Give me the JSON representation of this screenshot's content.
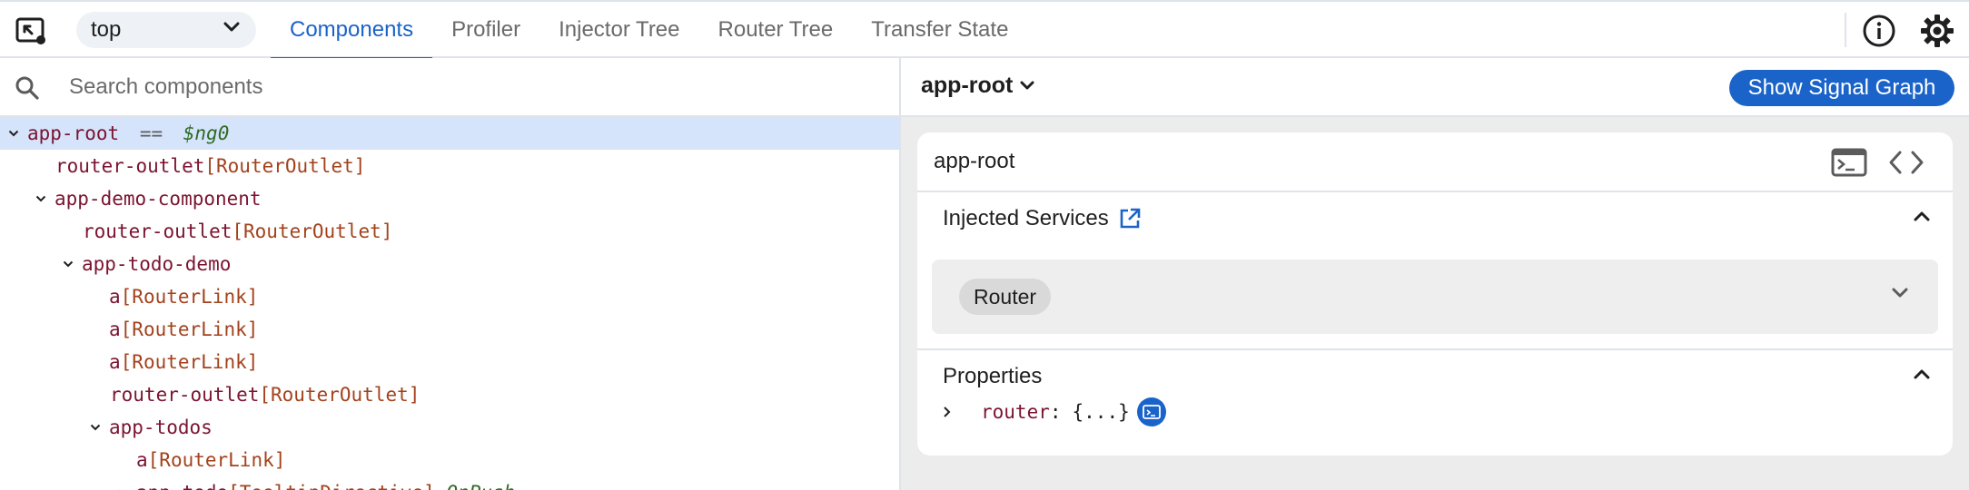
{
  "toolbar": {
    "frame_value": "top",
    "tabs": [
      {
        "label": "Components"
      },
      {
        "label": "Profiler"
      },
      {
        "label": "Injector Tree"
      },
      {
        "label": "Router Tree"
      },
      {
        "label": "Transfer State"
      }
    ],
    "active_tab": "Components"
  },
  "search": {
    "placeholder": "Search components",
    "value": ""
  },
  "tree": {
    "nodes": [
      {
        "element": "app-root",
        "directive": "",
        "eq": "==",
        "var": "$ng0",
        "expanded": true,
        "selected": true
      },
      {
        "element": "router-outlet",
        "directive": "[RouterOutlet]"
      },
      {
        "element": "app-demo-component",
        "directive": "",
        "expanded": true
      },
      {
        "element": "router-outlet",
        "directive": "[RouterOutlet]"
      },
      {
        "element": "app-todo-demo",
        "directive": "",
        "expanded": true
      },
      {
        "element": "a",
        "directive": "[RouterLink]"
      },
      {
        "element": "a",
        "directive": "[RouterLink]"
      },
      {
        "element": "a",
        "directive": "[RouterLink]"
      },
      {
        "element": "router-outlet",
        "directive": "[RouterOutlet]"
      },
      {
        "element": "app-todos",
        "directive": "",
        "expanded": true
      },
      {
        "element": "a",
        "directive": "[RouterLink]"
      },
      {
        "element": "app-todo",
        "directive": "[TooltipDirective]",
        "suffix": "OnPush",
        "expanded": true
      }
    ]
  },
  "details": {
    "selected_name": "app-root",
    "signal_graph_label": "Show Signal Graph",
    "card_title": "app-root",
    "injected_services": {
      "title": "Injected Services",
      "services": [
        "Router"
      ]
    },
    "properties": {
      "title": "Properties",
      "items": [
        {
          "key": "router",
          "colon": ":",
          "value": "{...}"
        }
      ]
    }
  },
  "colors": {
    "accent": "#1a63c9",
    "selected_row": "#d5e3fb",
    "element_name": "#7b1430",
    "directive_name": "#a3421c",
    "variable": "#2e6b23"
  },
  "icons": [
    "inspect-icon",
    "chevron-down-icon",
    "info-icon",
    "gear-icon",
    "search-icon",
    "terminal-icon",
    "code-icon",
    "external-link-icon",
    "chevron-up-icon",
    "chevron-right-icon"
  ]
}
